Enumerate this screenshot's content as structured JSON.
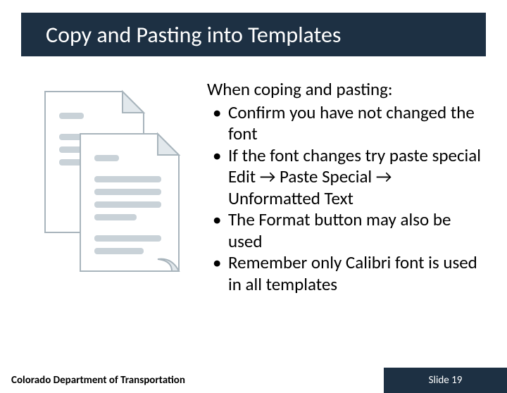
{
  "title": "Copy and Pasting into Templates",
  "lead": "When coping and pasting:",
  "bullets": [
    "Confirm you have not changed the font",
    "If the font changes try paste special Edit → Paste Special → Unformatted Text",
    "The Format button may also be used",
    "Remember only Calibri font is used in all templates"
  ],
  "footer_left": "Colorado Department of Transportation",
  "footer_right": "Slide 19"
}
